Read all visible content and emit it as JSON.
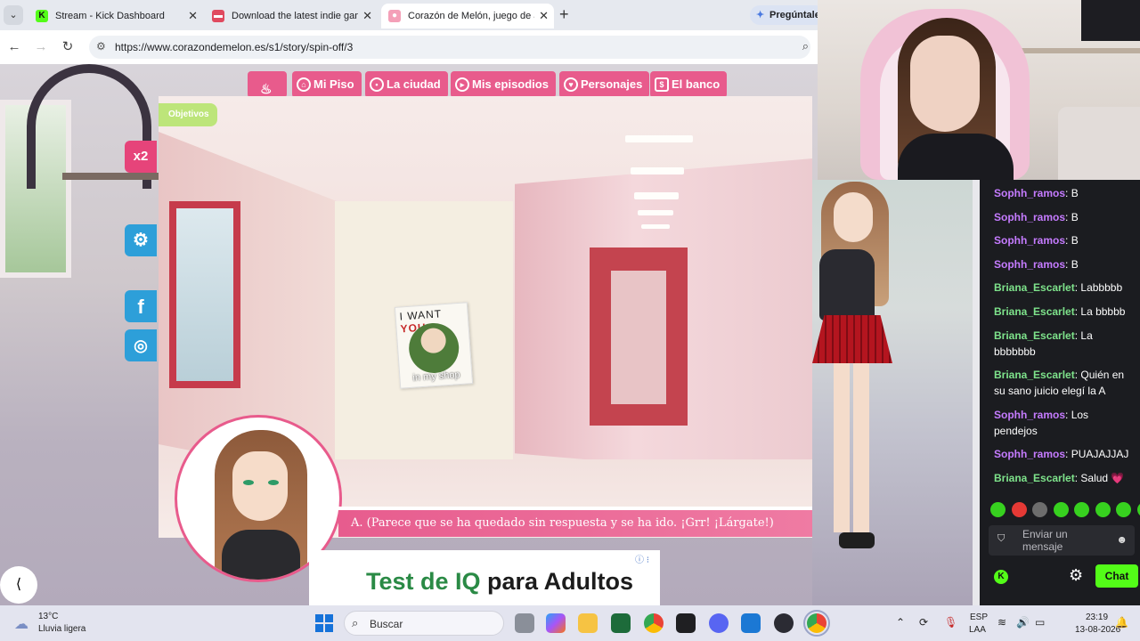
{
  "browser": {
    "tabs": [
      {
        "title": "Stream - Kick Dashboard",
        "icon": "kick-icon"
      },
      {
        "title": "Download the latest indie games",
        "icon": "itch-icon"
      },
      {
        "title": "Corazón de Melón, juego de amor",
        "icon": "melon-icon"
      }
    ],
    "ask_label": "Pregúntale",
    "url": "https://www.corazondemelon.es/s1/story/spin-off/3"
  },
  "game": {
    "nav": [
      "Mi Piso",
      "La ciudad",
      "Mis episodios",
      "Personajes",
      "El banco"
    ],
    "objetivos": "Objetivos",
    "multiplier": "x2",
    "poster": {
      "line1": "I WANT ",
      "line1_red": "YOU",
      "line2": "in my shop"
    },
    "dialog": "A. (Parece que se ha quedado sin respuesta y se ha ido. ¡Grr! ¡Lárgate!)"
  },
  "ad": {
    "part1": "Test de IQ",
    "part2": " para Adultos"
  },
  "chat": {
    "messages": [
      {
        "user": "Sophh_ramos",
        "text": "B",
        "color": "#c57bff"
      },
      {
        "user": "Sophh_ramos",
        "text": "B",
        "color": "#c57bff"
      },
      {
        "user": "Sophh_ramos",
        "text": "B",
        "color": "#c57bff"
      },
      {
        "user": "Sophh_ramos",
        "text": "B",
        "color": "#c57bff"
      },
      {
        "user": "Briana_Escarlet",
        "text": "Labbbbb",
        "color": "#7ee38b"
      },
      {
        "user": "Briana_Escarlet",
        "text": "La bbbbb",
        "color": "#7ee38b"
      },
      {
        "user": "Briana_Escarlet",
        "text": "La bbbbbbb",
        "color": "#7ee38b"
      },
      {
        "user": "Briana_Escarlet",
        "text": "Quién en su sano juicio elegí la A",
        "color": "#7ee38b"
      },
      {
        "user": "Sophh_ramos",
        "text": "Los pendejos",
        "color": "#c57bff"
      },
      {
        "user": "Sophh_ramos",
        "text": "PUAJAJJAJ",
        "color": "#c57bff"
      },
      {
        "user": "Briana_Escarlet",
        "text": "Salud 💗",
        "color": "#7ee38b"
      }
    ],
    "input_placeholder": "Enviar un mensaje",
    "send_label": "Chat"
  },
  "taskbar": {
    "temp": "13°C",
    "weather": "Lluvia ligera",
    "search_placeholder": "Buscar",
    "lang1": "ESP",
    "lang2": "LAA",
    "time": "23:19",
    "date": "13-08-2026"
  }
}
